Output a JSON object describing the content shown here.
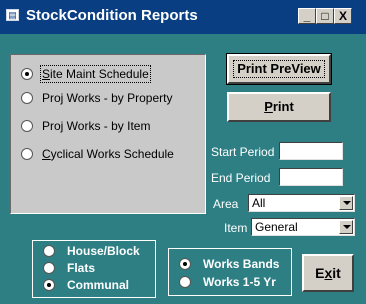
{
  "window": {
    "title": "StockCondition Reports",
    "icon": "form-icon",
    "controls": {
      "minimize": "_",
      "maximize": "□",
      "close": "X"
    }
  },
  "report_options": [
    {
      "label": "Site Maint Schedule",
      "underline": "S",
      "rest": "ite Maint Schedule",
      "selected": true
    },
    {
      "label": "Proj Works - by Property",
      "underline": "",
      "rest": "Proj Works - by Property",
      "selected": false
    },
    {
      "label": "Proj Works - by Item",
      "underline": "",
      "rest": "Proj Works - by Item",
      "selected": false
    },
    {
      "label": "Cyclical Works Schedule",
      "underline": "C",
      "rest": "yclical Works Schedule",
      "selected": false
    }
  ],
  "buttons": {
    "print_preview": "Print PreView",
    "print_underline": "P",
    "print_rest": "rint",
    "exit_underline": "x",
    "exit_first": "E",
    "exit_rest": "it"
  },
  "fields": {
    "start_period_label": "Start Period",
    "start_period_value": "",
    "end_period_label": "End Period",
    "end_period_value": "",
    "area_label": "Area",
    "area_value": "All",
    "item_label": "Item",
    "item_value": "General"
  },
  "property_types": [
    {
      "label": "House/Block",
      "selected": false
    },
    {
      "label": "Flats",
      "selected": false
    },
    {
      "label": "Communal",
      "selected": true
    }
  ],
  "works_types": [
    {
      "label": "Works Bands",
      "selected": true
    },
    {
      "label": "Works 1-5 Yr",
      "selected": false
    }
  ],
  "colors": {
    "titlebar": "#0a3e82",
    "client_bg": "#2e7f84",
    "panel_bg": "#c9c9c9",
    "button_face": "#d4d0c8"
  }
}
